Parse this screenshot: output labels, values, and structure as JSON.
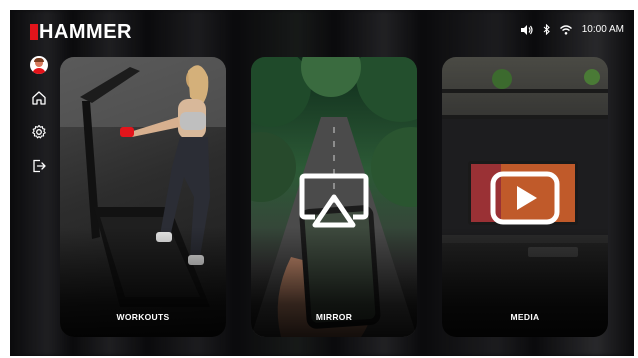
{
  "brand": {
    "name": "HAMMER",
    "accent": "#e3141b"
  },
  "status_bar": {
    "icons": [
      "volume-icon",
      "bluetooth-icon",
      "wifi-icon"
    ],
    "time": "10:00 AM"
  },
  "sidebar": {
    "items": [
      {
        "name": "profile",
        "icon": "avatar"
      },
      {
        "name": "home",
        "icon": "home-icon"
      },
      {
        "name": "settings",
        "icon": "gear-icon"
      },
      {
        "name": "logout",
        "icon": "logout-icon"
      }
    ]
  },
  "cards": [
    {
      "id": "workouts",
      "label": "WORKOUTS"
    },
    {
      "id": "mirror",
      "label": "MIRROR",
      "icon": "airplay-icon"
    },
    {
      "id": "media",
      "label": "MEDIA",
      "icon": "play-icon"
    }
  ]
}
